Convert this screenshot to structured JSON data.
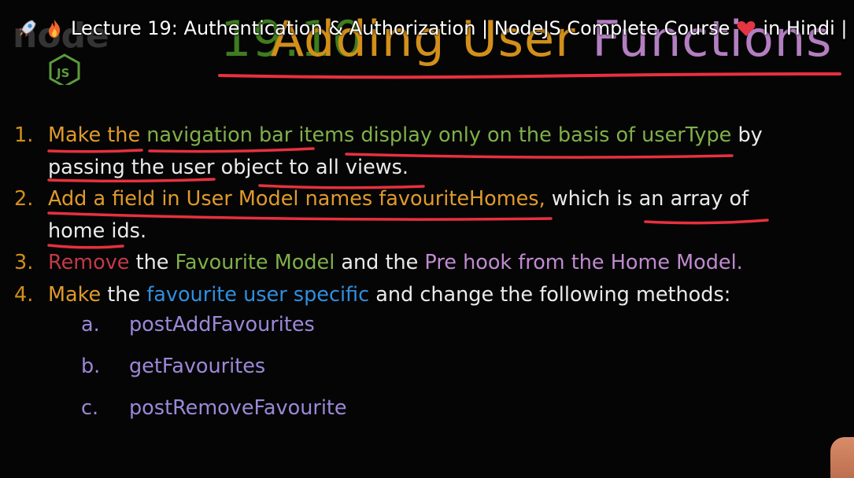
{
  "video": {
    "title": "Lecture 19: Authentication & Authorization | NodeJS Complete Course",
    "title_tail": "in Hindi |",
    "emojis": [
      "rocket-emoji",
      "fire-emoji",
      "heart-emoji"
    ]
  },
  "slide": {
    "title_number": "19.10",
    "title_word1": "Adding",
    "title_word2": "User",
    "title_word3": "Functions",
    "items": [
      {
        "number": "1.",
        "line1": [
          {
            "text": "Make the ",
            "color": "orange"
          },
          {
            "text": "navigation bar items display only on the basis of userType",
            "color": "green"
          },
          {
            "text": " by",
            "color": "white"
          }
        ],
        "line2": [
          {
            "text": "passing the user",
            "color": "white"
          },
          {
            "text": " object to all views.",
            "color": "white"
          }
        ]
      },
      {
        "number": "2.",
        "line1": [
          {
            "text": "Add a field in User Model names favouriteHomes,",
            "color": "orange"
          },
          {
            "text": " which is an array of",
            "color": "white"
          }
        ],
        "line2": [
          {
            "text": "home ids.",
            "color": "white"
          }
        ]
      },
      {
        "number": "3.",
        "line1": [
          {
            "text": "Remove",
            "color": "red"
          },
          {
            "text": " the ",
            "color": "white"
          },
          {
            "text": "Favourite Model",
            "color": "green"
          },
          {
            "text": " and the ",
            "color": "white"
          },
          {
            "text": "Pre hook from the Home Model.",
            "color": "purple"
          }
        ]
      },
      {
        "number": "4.",
        "line1": [
          {
            "text": "Make",
            "color": "orange"
          },
          {
            "text": " the ",
            "color": "white"
          },
          {
            "text": "favourite user specific",
            "color": "blue"
          },
          {
            "text": " and change the following methods:",
            "color": "white"
          }
        ]
      }
    ],
    "sub_items": [
      {
        "letter": "a.",
        "text": "postAddFavourites"
      },
      {
        "letter": "b.",
        "text": "getFavourites"
      },
      {
        "letter": "c.",
        "text": "postRemoveFavourite"
      }
    ]
  },
  "colors": {
    "orange": "#e09a2a",
    "green": "#7fb04a",
    "red": "#c23a47",
    "purple": "#c08ad0",
    "blue": "#2f8fe0",
    "white": "#ebebeb",
    "annotation": "#e8303f"
  },
  "logo": {
    "text": "JS"
  }
}
